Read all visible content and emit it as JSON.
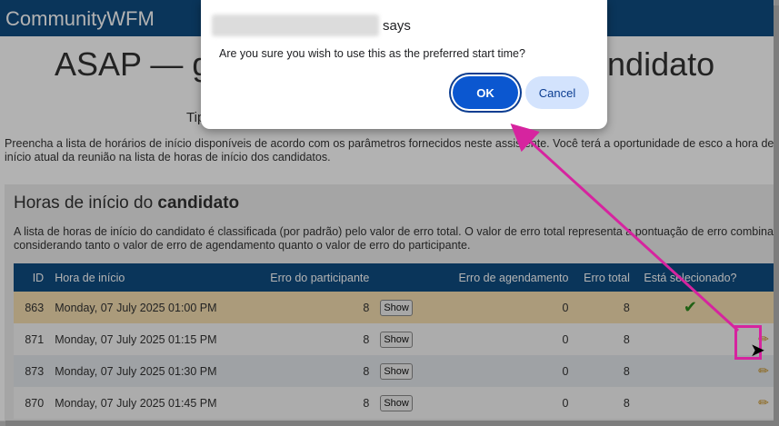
{
  "app": {
    "brand": "CommunityWFM"
  },
  "page": {
    "title_left": "ASAP — g",
    "title_right": "andidato",
    "subtitle_partial": "Tip",
    "intro": "Preencha a lista de horários de início disponíveis de acordo com os parâmetros fornecidos neste assistente. Você terá a oportunidade de esco a hora de início atual da reunião na lista de horas de início dos candidatos."
  },
  "section": {
    "title_prefix": "Horas de início do ",
    "title_bold": "candidato",
    "description": "A lista de horas de início do candidato é classificada (por padrão) pelo valor de erro total. O valor de erro total representa a pontuação de erro combinada considerando tanto o valor de erro de agendamento quanto o valor de erro do participante."
  },
  "table": {
    "headers": {
      "id": "ID",
      "start_time": "Hora de início",
      "participant_error": "Erro do participante",
      "schedule_error": "Erro de agendamento",
      "total_error": "Erro total",
      "selected": "Está selecionado?"
    },
    "show_label": "Show",
    "rows": [
      {
        "id": "863",
        "start": "Monday, 07 July 2025 01:00 PM",
        "participant_error": "8",
        "schedule_error": "0",
        "total_error": "8",
        "selected": true
      },
      {
        "id": "871",
        "start": "Monday, 07 July 2025 01:15 PM",
        "participant_error": "8",
        "schedule_error": "0",
        "total_error": "8",
        "selected": false
      },
      {
        "id": "873",
        "start": "Monday, 07 July 2025 01:30 PM",
        "participant_error": "8",
        "schedule_error": "0",
        "total_error": "8",
        "selected": false
      },
      {
        "id": "870",
        "start": "Monday, 07 July 2025 01:45 PM",
        "participant_error": "8",
        "schedule_error": "0",
        "total_error": "8",
        "selected": false
      }
    ]
  },
  "dialog": {
    "says": "says",
    "message": "Are you sure you wish to use this as the preferred start time?",
    "ok_label": "OK",
    "cancel_label": "Cancel"
  },
  "icons": {
    "check": "check-icon",
    "pencil": "pencil-icon",
    "cursor": "mouse-cursor-icon"
  },
  "colors": {
    "header_blue": "#0f4c81",
    "selected_row": "#f5deb0",
    "ok_blue": "#0b57d0",
    "annotation_magenta": "#d6249f"
  }
}
